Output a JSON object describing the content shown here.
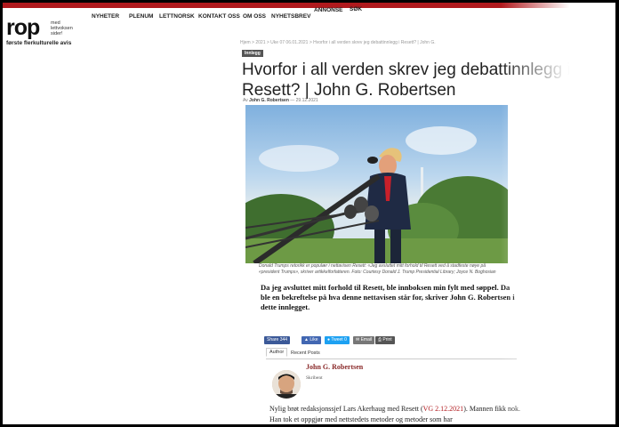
{
  "logo": {
    "name": "rop",
    "subtext": "med lettvoksen sider!",
    "tagline": "første flerkulturelle avis"
  },
  "nav": [
    "NYHETER",
    "PLENUM",
    "LETTNORSK",
    "KONTAKT OSS",
    "OM OSS",
    "NYHETSBREV",
    "ANNONSE",
    "SØK"
  ],
  "breadcrumb": "Hjem > 2021 > Uke 07 06.01.2021 > Hvorfor i all verden skrev jeg debattinnlegg i Resett? | John G.",
  "article": {
    "tag": "Innlegg",
    "title": "Hvorfor i all verden skrev jeg debattinnlegg i Resett? | John G. Robertsen",
    "byline_prefix": "Av",
    "byline_author": "John G. Robertsen",
    "byline_date": "29.12.2021",
    "caption": "Donald Trumps retorikk er populær i nettavisen Resett: «Jeg avsluttet mitt forhold til Resett ved å stadfeste nøye på «president Trumps», skriver artikkelforfatteren. Foto: Courtesy Donald J. Trump Presidential Library; Joyce N. Boghosian",
    "lead": "Da jeg avsluttet mitt forhold til Resett, ble innboksen min fylt med søppel. Da ble en bekreftelse på hva denne nettavisen står for, skriver John G. Robertsen i dette innlegget.",
    "body_start": "Nylig brøt redaksjonssjef Lars Akerhaug med Resett (",
    "body_link": "VG 2.12.2021",
    "body_end": "). Mannen fikk nok. Han tok et oppgjør med nettstedets metoder og metoder som har"
  },
  "share": {
    "facebook": "Share",
    "fb_count": "344",
    "like": "Like",
    "tweet": "Tweet",
    "tweet_count": "0",
    "email": "Email",
    "print": "Print"
  },
  "tabs": [
    "Author",
    "Recent Posts"
  ],
  "author": {
    "name": "John G. Robertsen",
    "role": "Skribent"
  },
  "colors": {
    "brand_red": "#b0191d",
    "facebook": "#3b5998",
    "twitter": "#1da1f2"
  }
}
